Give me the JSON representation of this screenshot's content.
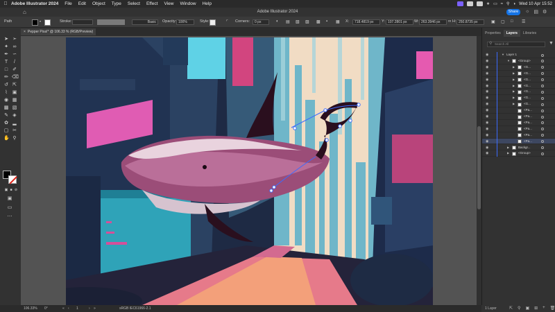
{
  "menubar": {
    "app_name": "Adobe Illustrator 2024",
    "items": [
      "File",
      "Edit",
      "Object",
      "Type",
      "Select",
      "Effect",
      "View",
      "Window",
      "Help"
    ],
    "clock": "Wed 10 Apr  15:52"
  },
  "titlebar": {
    "title": "Adobe Illustrator 2024",
    "share_label": "Share"
  },
  "controlbar": {
    "selection_label": "Path",
    "stroke_label": "Stroke:",
    "brush_label": "Basic",
    "opacity_label": "Opacity:",
    "opacity_value": "100%",
    "style_label": "Style:",
    "corners_label": "Corners:",
    "corners_value": "0 px",
    "x_value": "718.4819 px",
    "y_value": "107.2801 px",
    "w_value": "263.3946 px",
    "h_value": "250.8735 px"
  },
  "document": {
    "tab_title": "Pepper Pixa!* @ 106.33 % (RGB/Preview)"
  },
  "statusbar": {
    "zoom": "106.33%",
    "angle": "0°",
    "page": "1",
    "color_profile": "sRGB IEC61966-2.1"
  },
  "rpanel": {
    "tabs": [
      "Properties",
      "Layers",
      "Libraries"
    ],
    "active_tab": "Layers",
    "search_placeholder": "Search All",
    "layers": [
      {
        "name": "Layer 1",
        "indent": 0,
        "caret": "open",
        "thumb": false
      },
      {
        "name": "<Group>",
        "indent": 1,
        "caret": "open",
        "thumb": true
      },
      {
        "name": "<G...",
        "indent": 2,
        "caret": "closed",
        "thumb": true
      },
      {
        "name": "<G...",
        "indent": 2,
        "caret": "closed",
        "thumb": true
      },
      {
        "name": "<G...",
        "indent": 2,
        "caret": "closed",
        "thumb": true
      },
      {
        "name": "<G...",
        "indent": 2,
        "caret": "closed",
        "thumb": true
      },
      {
        "name": "<G...",
        "indent": 2,
        "caret": "closed",
        "thumb": true
      },
      {
        "name": "<G...",
        "indent": 2,
        "caret": "closed",
        "thumb": true
      },
      {
        "name": "<G...",
        "indent": 2,
        "caret": "closed",
        "thumb": true
      },
      {
        "name": "<Pa...",
        "indent": 2,
        "caret": "none",
        "thumb": true
      },
      {
        "name": "<Pa...",
        "indent": 2,
        "caret": "none",
        "thumb": true
      },
      {
        "name": "<Pa...",
        "indent": 2,
        "caret": "none",
        "thumb": true
      },
      {
        "name": "<Pa...",
        "indent": 2,
        "caret": "none",
        "thumb": true
      },
      {
        "name": "<Pa...",
        "indent": 2,
        "caret": "none",
        "thumb": true
      },
      {
        "name": "<Pa...",
        "indent": 2,
        "caret": "none",
        "thumb": true,
        "selected": true
      },
      {
        "name": "Backgr...",
        "indent": 1,
        "caret": "closed",
        "thumb": true
      },
      {
        "name": "<Group>",
        "indent": 1,
        "caret": "closed",
        "thumb": true
      }
    ],
    "layer_count": "1 Layer"
  },
  "colors": {
    "selection_blue": "#3b6bff",
    "share_blue": "#1473e6",
    "art_sky": "#f1dcc4",
    "art_whale": "#9b4d78",
    "art_street": "#e67a8a"
  }
}
